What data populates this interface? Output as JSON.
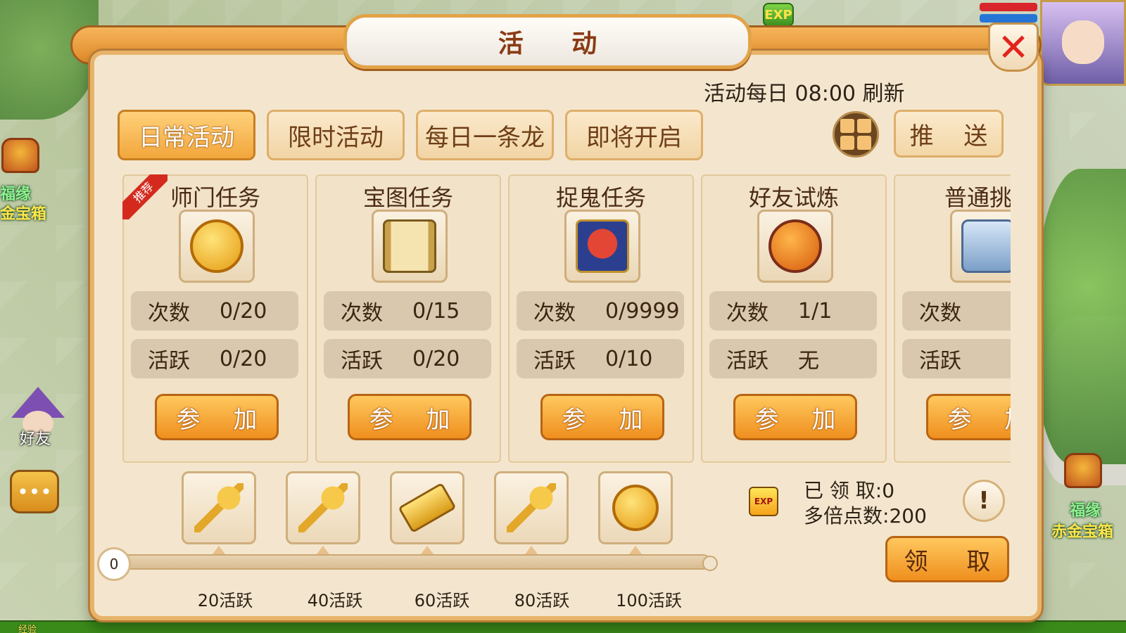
{
  "world": {
    "left_chest_label_top": "福缘",
    "left_chest_label_bottom": "金宝箱",
    "right_chest_label_top": "福缘",
    "right_chest_label_bottom": "赤金宝箱",
    "friend_label": "好友",
    "exp_badge": "EXP",
    "exp_bar_label": "经验"
  },
  "panel": {
    "title": "活 动",
    "close_glyph": "✕",
    "refresh_note": "活动每日 08:00 刷新"
  },
  "tabs": [
    {
      "label": "日常活动",
      "active": true
    },
    {
      "label": "限时活动",
      "active": false
    },
    {
      "label": "每日一条龙",
      "active": false
    },
    {
      "label": "即将开启",
      "active": false
    }
  ],
  "push_button": "推 送",
  "activities": [
    {
      "name": "师门任务",
      "icon": "coin-icon",
      "recommended_label": "推荐",
      "count_label": "次数",
      "count_value": "0/20",
      "active_label": "活跃",
      "active_value": "0/20",
      "join_label": "参 加"
    },
    {
      "name": "宝图任务",
      "icon": "treasure-map-icon",
      "recommended_label": "",
      "count_label": "次数",
      "count_value": "0/15",
      "active_label": "活跃",
      "active_value": "0/20",
      "join_label": "参 加"
    },
    {
      "name": "捉鬼任务",
      "icon": "ghost-mask-icon",
      "recommended_label": "",
      "count_label": "次数",
      "count_value": "0/9999",
      "active_label": "活跃",
      "active_value": "0/10",
      "join_label": "参 加"
    },
    {
      "name": "好友试炼",
      "icon": "mace-icon",
      "recommended_label": "",
      "count_label": "次数",
      "count_value": "1/1",
      "active_label": "活跃",
      "active_value": "无",
      "join_label": "参 加"
    },
    {
      "name": "普通挑",
      "icon": "chest-icon",
      "recommended_label": "",
      "count_label": "次数",
      "count_value": "",
      "active_label": "活跃",
      "active_value": "",
      "join_label": "参 加"
    }
  ],
  "rewards": {
    "start_value": "0",
    "progress": 0,
    "items": [
      {
        "icon": "gold-key-icon",
        "milestone": "20活跃"
      },
      {
        "icon": "gold-key-icon",
        "milestone": "40活跃"
      },
      {
        "icon": "gold-bar-icon",
        "milestone": "60活跃"
      },
      {
        "icon": "gold-key-icon",
        "milestone": "80活跃"
      },
      {
        "icon": "gold-coin-icon",
        "milestone": "100活跃"
      }
    ]
  },
  "claim": {
    "exp_icon_text": "EXP",
    "claimed_label": "已 领 取:",
    "claimed_value": "0",
    "multiplier_label": "多倍点数:",
    "multiplier_value": "200",
    "info_glyph": "!",
    "claim_button": "领 取"
  }
}
